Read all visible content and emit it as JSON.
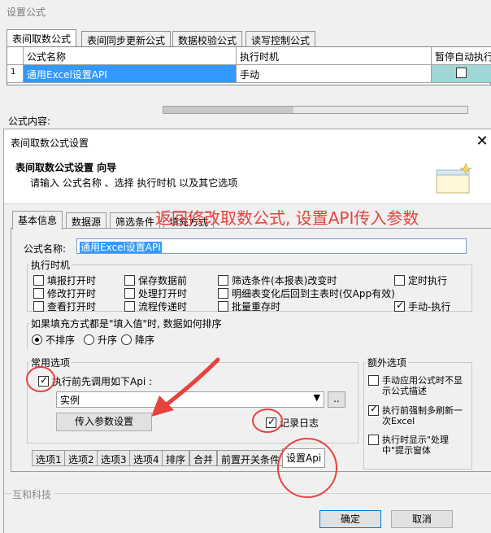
{
  "bg_window": {
    "title": "设置公式",
    "tabs": [
      "表间取数公式",
      "表间同步更新公式",
      "数据校验公式",
      "读写控制公式"
    ],
    "grid": {
      "columns": [
        "公式名称",
        "执行时机",
        "暂停自动执行"
      ],
      "rows": [
        {
          "index": "1",
          "name": "通用Excel设置API",
          "timing": "手动",
          "paused": false
        }
      ]
    },
    "content_label": "公式内容:"
  },
  "dialog": {
    "title": "表间取数公式设置",
    "close_glyph": "✕",
    "header_title": "表间取数公式设置 向导",
    "header_subtitle": "请输入 公式名称 、选择 执行时机 以及其它选项",
    "tabs": [
      "基本信息",
      "数据源",
      "筛选条件",
      "填充方式"
    ],
    "name_label": "公式名称:",
    "name_value": "通用Excel设置API",
    "timing": {
      "legend": "执行时机",
      "options": [
        {
          "label": "填报打开时",
          "checked": false
        },
        {
          "label": "保存数据前",
          "checked": false
        },
        {
          "label": "筛选条件(本报表)改变时",
          "checked": false
        },
        {
          "label": "定时执行",
          "checked": false
        },
        {
          "label": "修改打开时",
          "checked": false
        },
        {
          "label": "处理打开时",
          "checked": false
        },
        {
          "label": "明细表变化后回到主表时(仅App有效)",
          "checked": false
        },
        {
          "label": "查看打开时",
          "checked": false
        },
        {
          "label": "流程传递时",
          "checked": false
        },
        {
          "label": "批量重存时",
          "checked": false
        },
        {
          "label": "手动-执行",
          "checked": true
        }
      ]
    },
    "sort": {
      "legend": "如果填充方式都是\"填入值\"时, 数据如何排序",
      "options": [
        {
          "label": "不排序",
          "checked": true
        },
        {
          "label": "升序",
          "checked": false
        },
        {
          "label": "降序",
          "checked": false
        }
      ]
    },
    "common": {
      "legend": "常用选项",
      "call_api_label": "执行前先调用如下Api :",
      "call_api_checked": true,
      "api_selected": "实例",
      "more_label": "..",
      "param_button": "传入参数设置",
      "log_label": "记录日志",
      "log_checked": true
    },
    "extra": {
      "legend": "额外选项",
      "options": [
        {
          "label": "手动应用公式时不显示公式描述",
          "checked": false
        },
        {
          "label": "执行前强制多刷新一次Excel",
          "checked": true
        },
        {
          "label": "执行时显示\"处理中\"提示窗体",
          "checked": false
        }
      ]
    },
    "subtabs": [
      "选项1",
      "选项2",
      "选项3",
      "选项4",
      "排序",
      "合并",
      "前置开关条件",
      "设置Api"
    ],
    "brand": "互和科技",
    "ok": "确定",
    "cancel": "取消"
  },
  "annotation": {
    "text": "返回修改取数公式, 设置API传入参数",
    "color": "#e8413e"
  }
}
